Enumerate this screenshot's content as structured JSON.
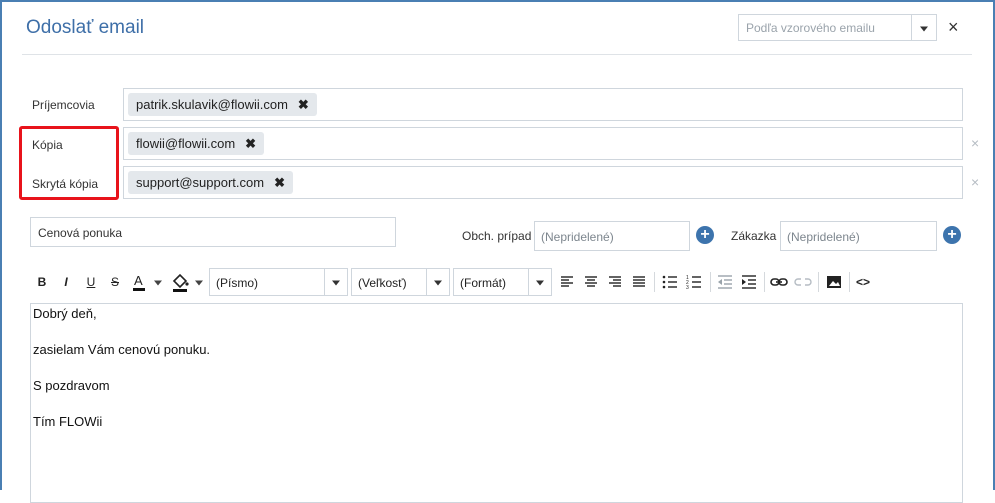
{
  "dialog": {
    "title": "Odoslať email",
    "template_placeholder": "Podľa vzorového emailu",
    "close": "×"
  },
  "recipients": {
    "to_label": "Príjemcovia",
    "to_chips": [
      "patrik.skulavik@flowii.com"
    ],
    "cc_label": "Kópia",
    "cc_chips": [
      "flowii@flowii.com"
    ],
    "bcc_label": "Skrytá kópia",
    "bcc_chips": [
      "support@support.com"
    ],
    "remove_glyph": "✖",
    "clear_glyph": "×"
  },
  "subject": {
    "value": "Cenová ponuka"
  },
  "deal": {
    "label": "Obch. prípad",
    "placeholder": "(Nepridelené)"
  },
  "customer": {
    "label": "Zákazka",
    "placeholder": "(Nepridelené)"
  },
  "toolbar": {
    "bold": "B",
    "italic": "I",
    "underline": "U",
    "strike": "S",
    "font": "(Písmo)",
    "size": "(Veľkosť)",
    "format": "(Formát)",
    "source": "<>",
    "icons": [
      "bold-icon",
      "italic-icon",
      "underline-icon",
      "strikethrough-icon",
      "text-color-icon",
      "fill-color-icon",
      "align-left-icon",
      "align-center-icon",
      "align-right-icon",
      "align-justify-icon",
      "bullet-list-icon",
      "numbered-list-icon",
      "outdent-icon",
      "indent-icon",
      "link-icon",
      "unlink-icon",
      "image-icon",
      "code-icon"
    ]
  },
  "body": {
    "lines": [
      "Dobrý deň,",
      "zasielam Vám cenovú ponuku.",
      "S pozdravom",
      "Tím FLOWii"
    ]
  },
  "colors": {
    "accent": "#3d74ad",
    "title": "#3e6fa8",
    "highlight": "#e8131b",
    "chip": "#e4e8ec",
    "border": "#cfd6dd"
  }
}
